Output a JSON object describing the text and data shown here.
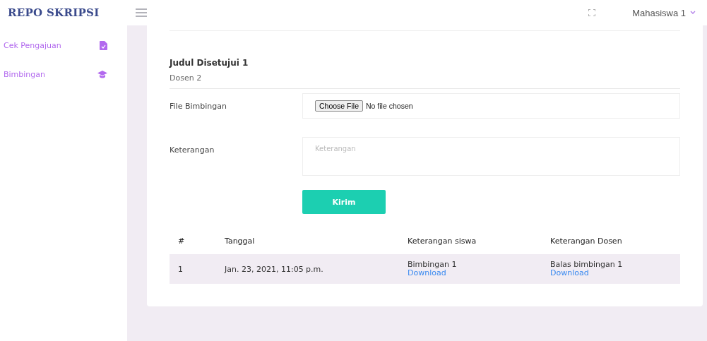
{
  "brand": "REPO SKRIPSI",
  "user": {
    "name": "Mahasiswa 1"
  },
  "sidebar": {
    "items": [
      {
        "label": "Cek Pengajuan",
        "selected": false
      },
      {
        "label": "Bimbingan",
        "selected": false
      }
    ]
  },
  "card": {
    "title": "Judul Disetujui 1",
    "subtitle": "Dosen 2",
    "form": {
      "file_label": "File Bimbingan",
      "file_button": "Choose File",
      "file_status": "No file chosen",
      "note_label": "Keterangan",
      "note_placeholder": "Keterangan",
      "submit": "Kirim"
    },
    "table": {
      "columns": [
        "#",
        "Tanggal",
        "Keterangan siswa",
        "Keterangan Dosen"
      ],
      "rows": [
        {
          "no": "1",
          "date": "Jan. 23, 2021, 11:05 p.m.",
          "student_note": "Bimbingan 1",
          "student_link": "Download",
          "lecturer_note": "Balas bimbingan 1",
          "lecturer_link": "Download"
        }
      ]
    }
  }
}
